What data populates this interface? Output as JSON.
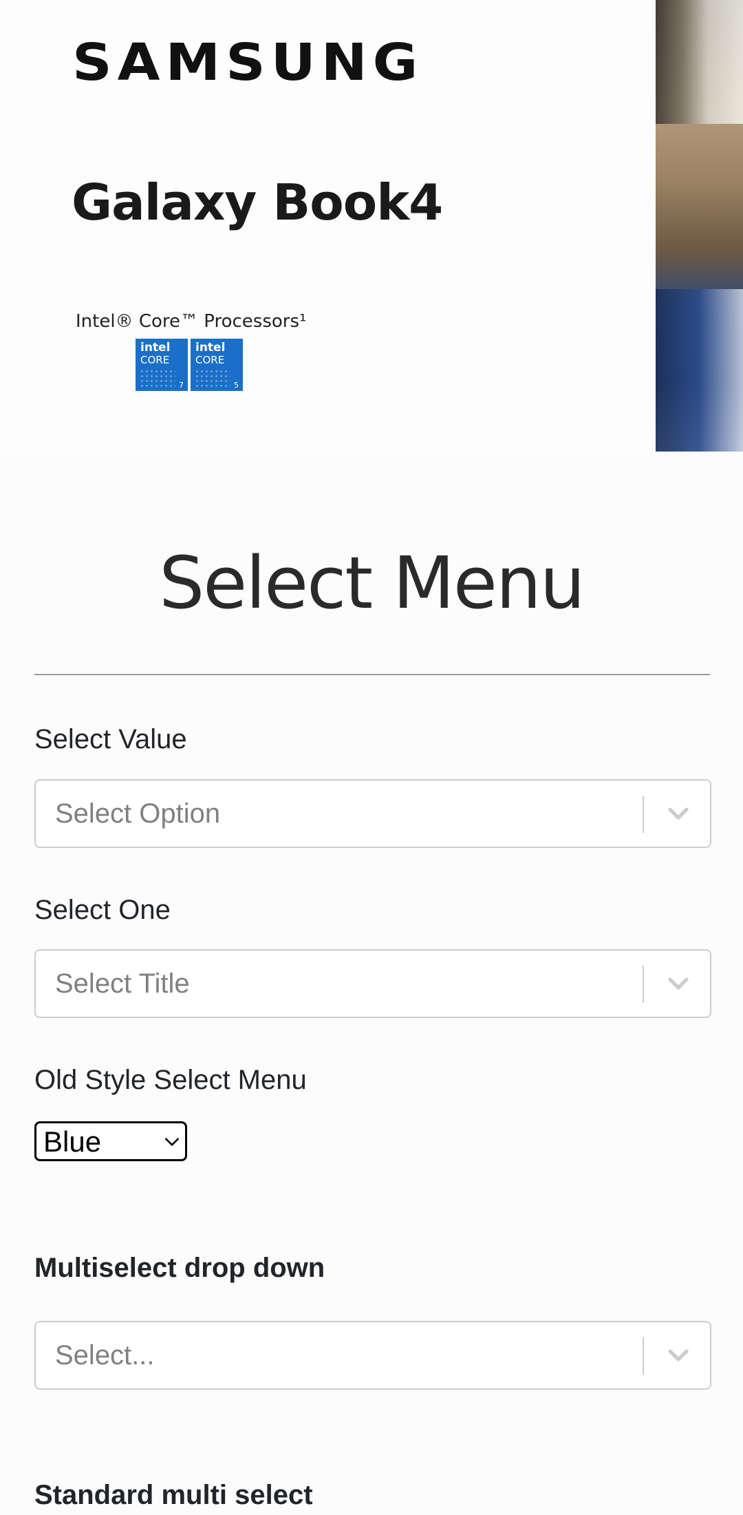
{
  "ad": {
    "brand": "SAMSUNG",
    "product": "Galaxy Book4",
    "tagline": "Intel® Core™ Processors¹",
    "badges": [
      {
        "line1": "intel",
        "line2": "CORE",
        "tier": "7"
      },
      {
        "line1": "intel",
        "line2": "CORE",
        "tier": "5"
      }
    ]
  },
  "header": {
    "title": "Select Menu"
  },
  "form": {
    "select_value": {
      "label": "Select Value",
      "placeholder": "Select Option"
    },
    "select_one": {
      "label": "Select One",
      "placeholder": "Select Title"
    },
    "old_style": {
      "label": "Old Style Select Menu",
      "selected": "Blue"
    },
    "multiselect": {
      "label": "Multiselect drop down",
      "placeholder": "Select..."
    },
    "standard_multi": {
      "label": "Standard multi select"
    }
  },
  "colors": {
    "border": "#cccccc",
    "placeholder": "#808080",
    "badge_blue": "#1b6fc8"
  },
  "icons": {
    "dropdown": "chevron-down-icon"
  }
}
